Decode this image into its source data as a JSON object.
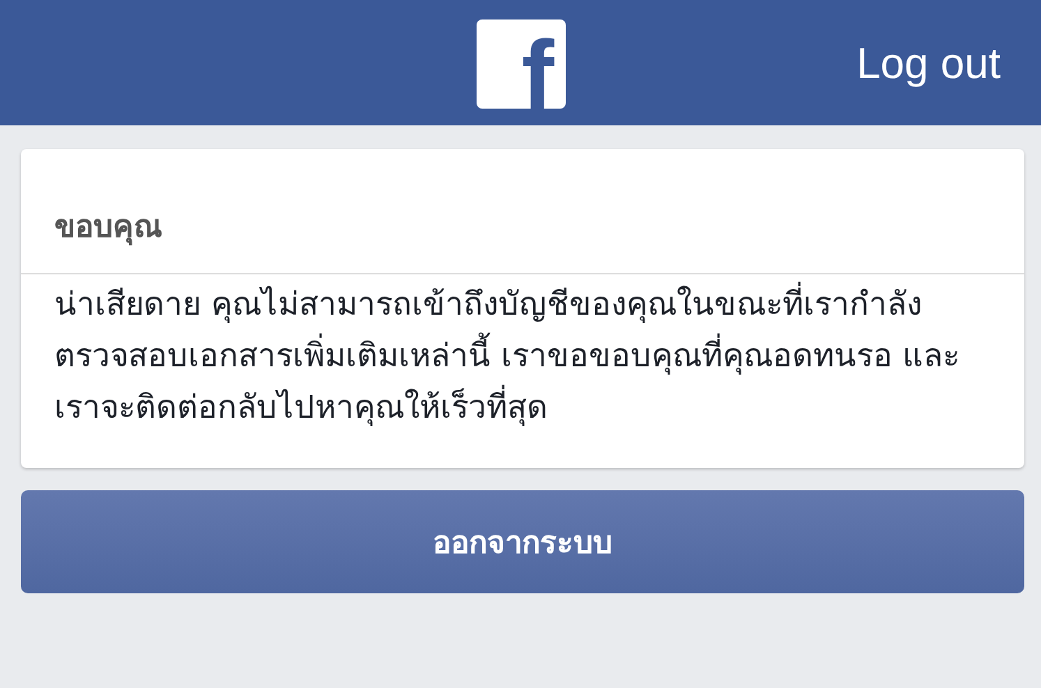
{
  "header": {
    "logo": "f",
    "action": "Log out"
  },
  "card": {
    "title": "ขอบคุณ",
    "message": "น่าเสียดาย คุณไม่สามารถเข้าถึงบัญชีของคุณในขณะที่เรากำลังตรวจสอบเอกสารเพิ่มเติมเหล่านี้ เราขอขอบคุณที่คุณอดทนรอ และเราจะติดต่อกลับไปหาคุณให้เร็วที่สุด"
  },
  "button": "ออกจากระบบ"
}
